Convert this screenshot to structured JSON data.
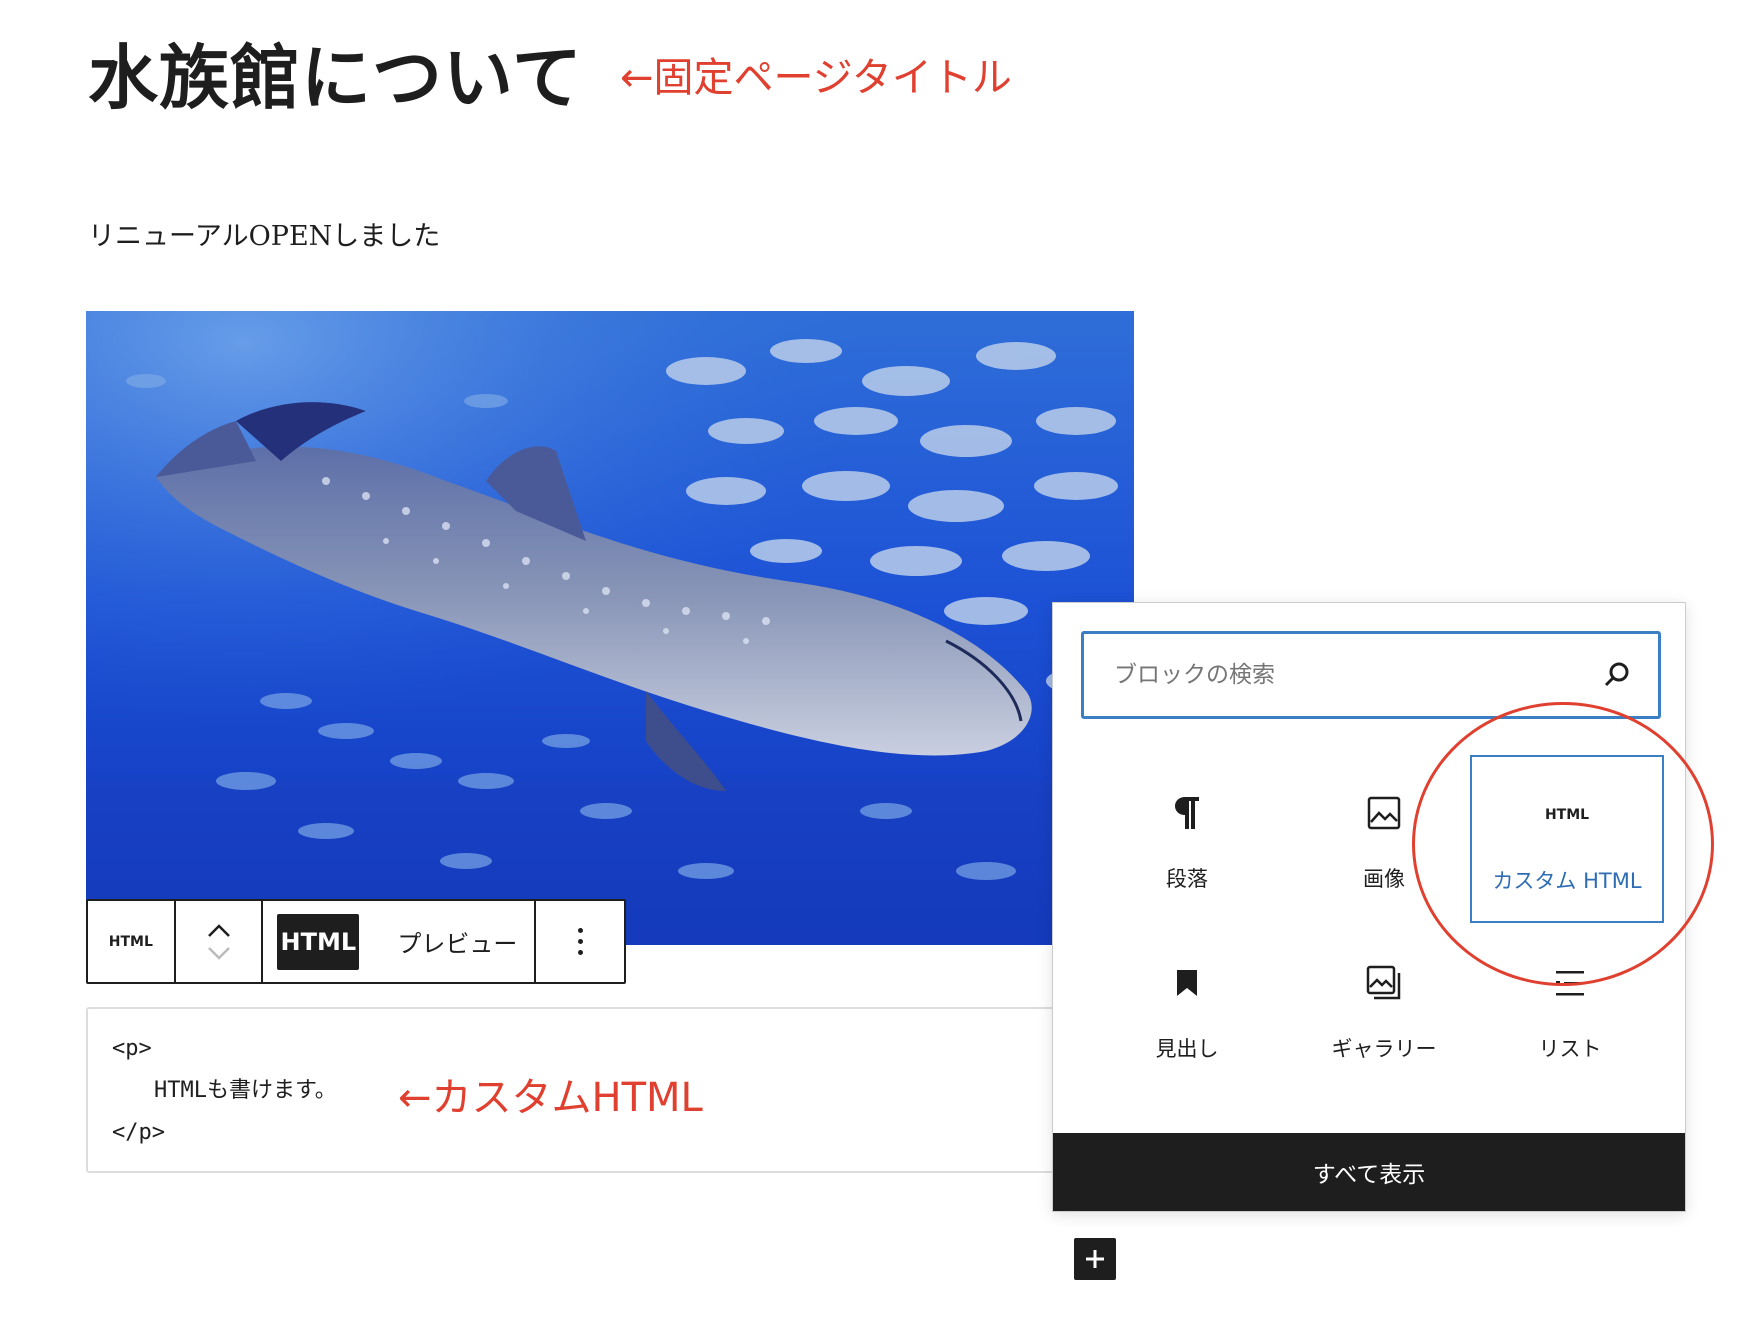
{
  "page": {
    "title": "水族館について",
    "paragraph": "リニューアルOPENしました"
  },
  "annotations": {
    "title_note": "←固定ページタイトル",
    "html_note": "←カスタムHTML",
    "color": "#e0402f"
  },
  "toolbar": {
    "block_type": "HTML",
    "html_label": "HTML",
    "preview_label": "プレビュー"
  },
  "code": {
    "line1": "<p>",
    "line2": "HTMLも書けます。",
    "line3": "</p>"
  },
  "inserter": {
    "search_placeholder": "ブロックの検索",
    "blocks": [
      {
        "label": "段落",
        "icon": "paragraph-icon"
      },
      {
        "label": "画像",
        "icon": "image-icon"
      },
      {
        "label": "カスタム HTML",
        "icon": "html-icon",
        "icon_text": "HTML",
        "selected": true
      },
      {
        "label": "見出し",
        "icon": "bookmark-icon"
      },
      {
        "label": "ギャラリー",
        "icon": "gallery-icon"
      },
      {
        "label": "リスト",
        "icon": "list-icon"
      }
    ],
    "show_all_label": "すべて表示"
  },
  "colors": {
    "accent": "#3a7fc4",
    "dark": "#1e1e1e"
  }
}
